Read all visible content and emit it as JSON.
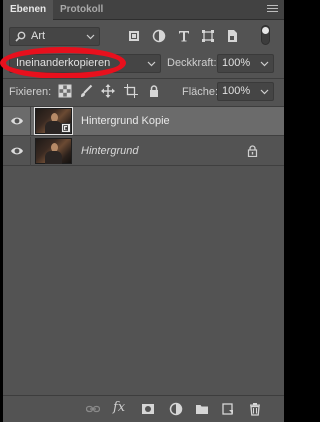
{
  "tabs": {
    "layers": "Ebenen",
    "history": "Protokoll"
  },
  "filter": {
    "label": "Art"
  },
  "blend": {
    "mode": "Ineinanderkopieren"
  },
  "opacity": {
    "label": "Deckkraft:",
    "value": "100%"
  },
  "lock": {
    "label": "Fixieren:"
  },
  "fill": {
    "label": "Fläche:",
    "value": "100%"
  },
  "layers": [
    {
      "name": "Hintergrund Kopie",
      "selected": true,
      "smart_object": true,
      "locked": false
    },
    {
      "name": "Hintergrund",
      "selected": false,
      "smart_object": false,
      "locked": true
    }
  ],
  "colors": {
    "panel": "#535353",
    "selected_row": "#6b6b6b",
    "highlight_ring": "#e8101d"
  }
}
